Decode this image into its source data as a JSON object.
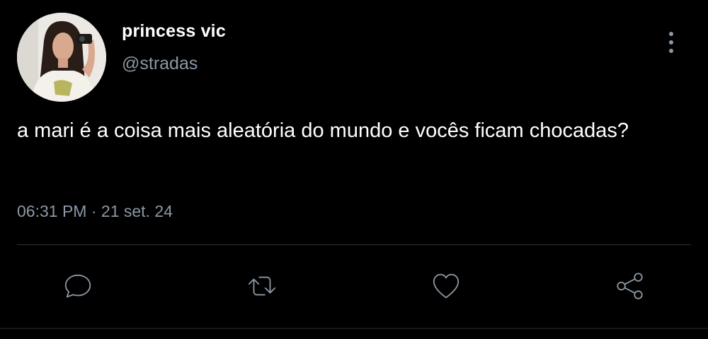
{
  "tweet": {
    "author": {
      "display_name": "princess vic",
      "handle": "@stradas"
    },
    "text": "a mari é a coisa mais aleatória do mundo e vocês ficam chocadas?",
    "time": "06:31 PM",
    "separator": "·",
    "date": "21 set. 24"
  },
  "actions": {
    "reply_icon": "reply-icon",
    "retweet_icon": "retweet-icon",
    "like_icon": "heart-icon",
    "share_icon": "share-icon",
    "more_icon": "more-vertical-icon"
  },
  "colors": {
    "background": "#000000",
    "primary_text": "#ffffff",
    "secondary_text": "#8b98a5",
    "divider": "#2f3336"
  }
}
